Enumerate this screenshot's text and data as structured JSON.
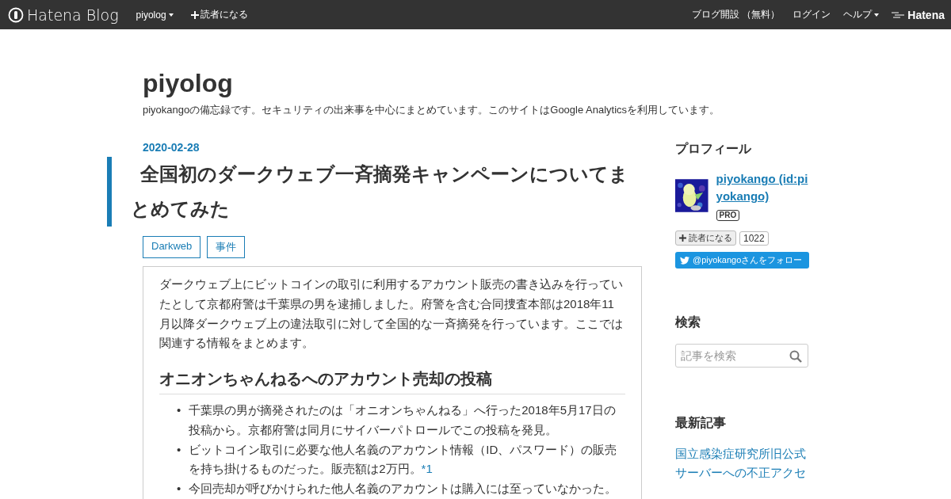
{
  "topbar": {
    "brand": "Hatena Blog",
    "blog_menu": "piyolog",
    "subscribe": "読者になる",
    "links": [
      {
        "label": "ブログ開設 （無料）",
        "kind": "link"
      },
      {
        "label": "ログイン",
        "kind": "link"
      },
      {
        "label": "ヘルプ",
        "kind": "menu"
      }
    ],
    "logo": "Hatena"
  },
  "header": {
    "title": "piyolog",
    "description": "piyokangoの備忘録です。セキュリティの出来事を中心にまとめています。このサイトはGoogle Analyticsを利用しています。"
  },
  "entry": {
    "date": "2020-02-28",
    "title": "全国初のダークウェブ一斉摘発キャンペーンについてまとめてみた",
    "categories": [
      "Darkweb",
      "事件"
    ],
    "intro": "ダークウェブ上にビットコインの取引に利用するアカウント販売の書き込みを行っていたとして京都府警は千葉県の男を逮捕しました。府警を含む合同捜査本部は2018年11月以降ダークウェブ上の違法取引に対して全国的な一斉摘発を行っています。ここでは関連する情報をまとめます。",
    "heading": "オニオンちゃんねるへのアカウント売却の投稿",
    "bullets": [
      {
        "marker": "•",
        "text": "千葉県の男が摘発されたのは「オニオンちゃんねる」へ行った2018年5月17日の投稿から。京都府警は同月にサイバーパトロールでこの投稿を発見。"
      },
      {
        "marker": "•",
        "text": "ビットコイン取引に必要な他人名義のアカウント情報（ID、パスワード）の販売を持ち掛けるものだった。販売額は2万円。",
        "footnote": "*1"
      },
      {
        "marker": "•",
        "text": "今回売却が呼びかけられた他人名義のアカウントは購入には至っていなかった。"
      }
    ]
  },
  "sidebar": {
    "profile": {
      "heading": "プロフィール",
      "name": "piyokango",
      "id": "(id:piyokango)",
      "badge": "PRO",
      "subscribe": "読者になる",
      "count": "1022",
      "twitter": "@piyokangoさんをフォロー"
    },
    "search": {
      "heading": "検索",
      "placeholder": "記事を検索"
    },
    "recent": {
      "heading": "最新記事",
      "items": [
        "国立感染症研究所旧公式サーバーへの不正アクセ"
      ]
    }
  }
}
